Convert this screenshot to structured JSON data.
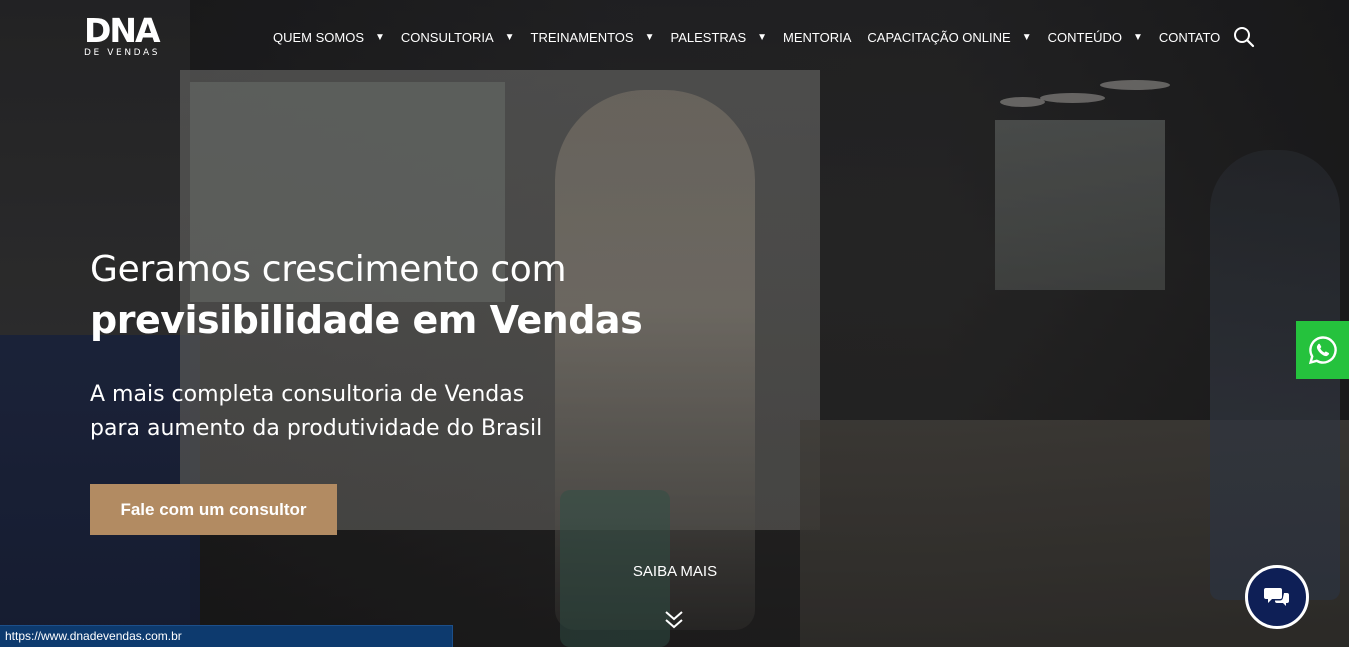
{
  "brand": {
    "logo_main": "DNA",
    "logo_sub": "DE VENDAS"
  },
  "nav": {
    "items": [
      {
        "label": "QUEM SOMOS",
        "has_dropdown": true
      },
      {
        "label": "CONSULTORIA",
        "has_dropdown": true
      },
      {
        "label": "TREINAMENTOS",
        "has_dropdown": true
      },
      {
        "label": "PALESTRAS",
        "has_dropdown": true
      },
      {
        "label": "MENTORIA",
        "has_dropdown": false
      },
      {
        "label": "CAPACITAÇÃO ONLINE",
        "has_dropdown": true
      },
      {
        "label": "CONTEÚDO",
        "has_dropdown": true
      },
      {
        "label": "CONTATO",
        "has_dropdown": false
      }
    ],
    "caret": "▼",
    "search_icon": "search-icon"
  },
  "hero": {
    "headline_line1": "Geramos crescimento com",
    "headline_line2": "previsibilidade em Vendas",
    "sub_line1": "A mais completa consultoria de Vendas",
    "sub_line2": "para aumento da produtividade do Brasil",
    "cta_label": "Fale com um consultor",
    "saiba_mais": "SAIBA MAIS"
  },
  "floating": {
    "whatsapp_icon": "whatsapp-icon",
    "chat_icon": "chat-bubbles-icon"
  },
  "status_bar": {
    "url": "https://www.dnadevendas.com.br"
  },
  "colors": {
    "cta": "#b28b62",
    "whatsapp": "#25c23d",
    "chat": "#0e1f56",
    "status_bar": "#0d3a6e"
  }
}
